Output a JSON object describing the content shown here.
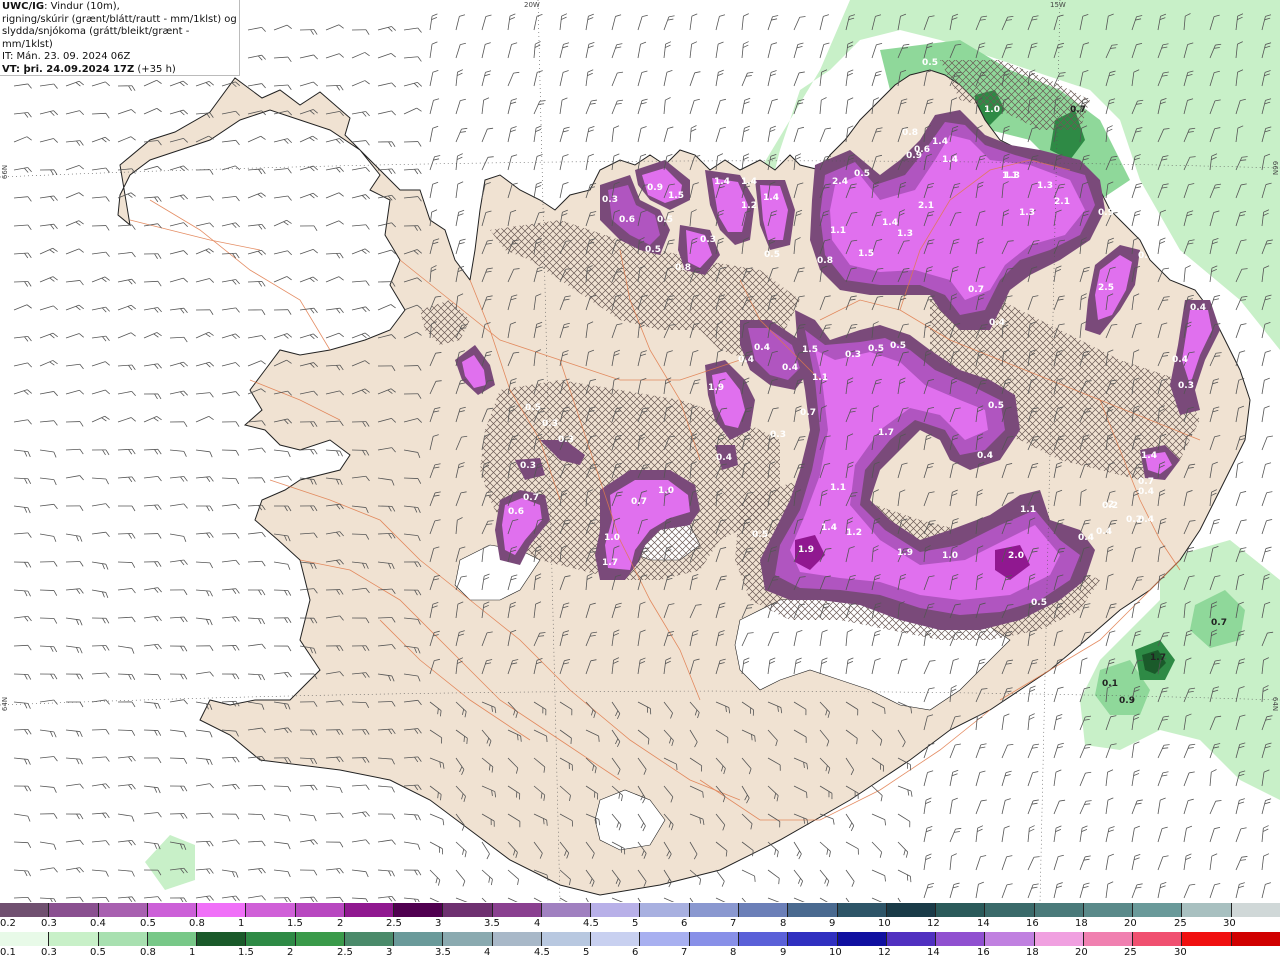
{
  "info": {
    "title": "UWC/IG",
    "line1_rest": ": Vindur (10m),",
    "line2": "rigning/skúrir (grænt/blátt/rautt - mm/1klst) og",
    "line3": "slydda/snjókoma (grátt/bleikt/grænt - mm/1klst)",
    "line4": "IT: Mán. 23. 09. 2024 06Z",
    "vt_label": "VT: þri. 24.09.2024 17Z",
    "vt_suffix": " (+35 h)"
  },
  "coords": {
    "top_20w": "20W",
    "top_15w": "15W",
    "left_66n": "66N",
    "left_64n": "64N",
    "right_66n": "66N",
    "right_64n": "64N"
  },
  "colors": {
    "land": "#f0e2d2",
    "sea": "#ffffff",
    "roads": "#e07a4a",
    "coast": "#222222",
    "snow_light": "#7a4a7a",
    "snow_mid": "#b055c0",
    "snow_heavy": "#e070ee",
    "rain_light": "#c8f0c8",
    "rain_mid": "#8fd89a",
    "rain_heavy": "#2e8a45",
    "rain_dark": "#1a5a2a"
  },
  "snow_scale": {
    "labels": [
      "0.2",
      "0.3",
      "0.4",
      "0.5",
      "0.8",
      "1",
      "1.5",
      "2",
      "2.5",
      "3",
      "3.5",
      "4",
      "4.5",
      "5",
      "6",
      "7",
      "8",
      "9",
      "10",
      "12",
      "14",
      "16",
      "18",
      "20",
      "25",
      "30"
    ],
    "colors": [
      "#705070",
      "#8a5090",
      "#a860b0",
      "#cc60d8",
      "#f070f8",
      "#d060d8",
      "#b848c0",
      "#901890",
      "#500050",
      "#6e3070",
      "#8a4090",
      "#a080c0",
      "#b8b0e8",
      "#a8b0e0",
      "#8a98d0",
      "#6b7fb8",
      "#4a6a90",
      "#2e5568",
      "#1a3b48",
      "#2a5a5a",
      "#3a6a6a",
      "#4a7a7a",
      "#5a8a8a",
      "#6a9a9a",
      "#a8c0c0",
      "#d0d8d8"
    ]
  },
  "rain_scale": {
    "labels": [
      "0.1",
      "0.3",
      "0.5",
      "0.8",
      "1",
      "1.5",
      "2",
      "2.5",
      "3",
      "3.5",
      "4",
      "4.5",
      "5",
      "6",
      "7",
      "8",
      "9",
      "10",
      "12",
      "14",
      "16",
      "18",
      "20",
      "25",
      "30"
    ],
    "colors": [
      "#e8fae8",
      "#c8f0c8",
      "#a8e0b0",
      "#78c888",
      "#1a5a2a",
      "#2e8a45",
      "#3a9a4a",
      "#4a8a6a",
      "#6a9a9a",
      "#8aaab0",
      "#a8b8c8",
      "#b8c8e0",
      "#c8d0f0",
      "#a8b0f0",
      "#8890e8",
      "#5a60d8",
      "#3030c0",
      "#1010a0",
      "#5030c0",
      "#9050d0",
      "#c080e0",
      "#f0a0e0",
      "#f080b0",
      "#f05070",
      "#f01010",
      "#d00000"
    ]
  },
  "precip_labels": [
    {
      "v": "0.5"
    },
    {
      "v": "0.7"
    },
    {
      "v": "0.8"
    },
    {
      "v": "1.0"
    },
    {
      "v": "0.9"
    },
    {
      "v": "0.6"
    },
    {
      "v": "1.4"
    },
    {
      "v": "1.4"
    },
    {
      "v": "1.3"
    },
    {
      "v": "1.3"
    },
    {
      "v": "2.1"
    },
    {
      "v": "2.1"
    },
    {
      "v": "1.1"
    },
    {
      "v": "0.9"
    },
    {
      "v": "0.7"
    },
    {
      "v": "1.3"
    },
    {
      "v": "2.5"
    },
    {
      "v": "0.7"
    },
    {
      "v": "0.4"
    },
    {
      "v": "0.4"
    },
    {
      "v": "0.4"
    },
    {
      "v": "2.4"
    },
    {
      "v": "1.1"
    },
    {
      "v": "1.4"
    },
    {
      "v": "1.3"
    },
    {
      "v": "1.5"
    },
    {
      "v": "0.8"
    },
    {
      "v": "0.5"
    },
    {
      "v": "0.9"
    },
    {
      "v": "0.6"
    },
    {
      "v": "0.5"
    },
    {
      "v": "1.5"
    },
    {
      "v": "0.3"
    },
    {
      "v": "0.5"
    },
    {
      "v": "0.8"
    },
    {
      "v": "1.4"
    },
    {
      "v": "1.4"
    },
    {
      "v": "1.2"
    },
    {
      "v": "1.4"
    },
    {
      "v": "0.3"
    },
    {
      "v": "0.5"
    },
    {
      "v": "0.4"
    },
    {
      "v": "0.4"
    },
    {
      "v": "0.4"
    },
    {
      "v": "1.9"
    },
    {
      "v": "0.3"
    },
    {
      "v": "1.5"
    },
    {
      "v": "1.1"
    },
    {
      "v": "0.7"
    },
    {
      "v": "0.3"
    },
    {
      "v": "0.5"
    },
    {
      "v": "0.5"
    },
    {
      "v": "1.7"
    },
    {
      "v": "0.5"
    },
    {
      "v": "0.4"
    },
    {
      "v": "0.4"
    },
    {
      "v": "0.3"
    },
    {
      "v": "0.2"
    },
    {
      "v": "0.3"
    },
    {
      "v": "0.3"
    },
    {
      "v": "0.5"
    },
    {
      "v": "0.3"
    },
    {
      "v": "0.7"
    },
    {
      "v": "0.6"
    },
    {
      "v": "1.1"
    },
    {
      "v": "1.0"
    },
    {
      "v": "0.7"
    },
    {
      "v": "1.0"
    },
    {
      "v": "1.7"
    },
    {
      "v": "1.1"
    },
    {
      "v": "0.5"
    },
    {
      "v": "1.4"
    },
    {
      "v": "1.2"
    },
    {
      "v": "1.9"
    },
    {
      "v": "1.9"
    },
    {
      "v": "1.0"
    },
    {
      "v": "2.0"
    },
    {
      "v": "0.4"
    },
    {
      "v": "0.4"
    },
    {
      "v": "0.5"
    },
    {
      "v": "1.4"
    },
    {
      "v": "0.7"
    },
    {
      "v": "0.4"
    },
    {
      "v": "2"
    },
    {
      "v": "0.7"
    },
    {
      "v": "1.7"
    },
    {
      "v": "0.1"
    },
    {
      "v": "0.9"
    },
    {
      "v": "0.2"
    },
    {
      "v": "0.4"
    }
  ]
}
